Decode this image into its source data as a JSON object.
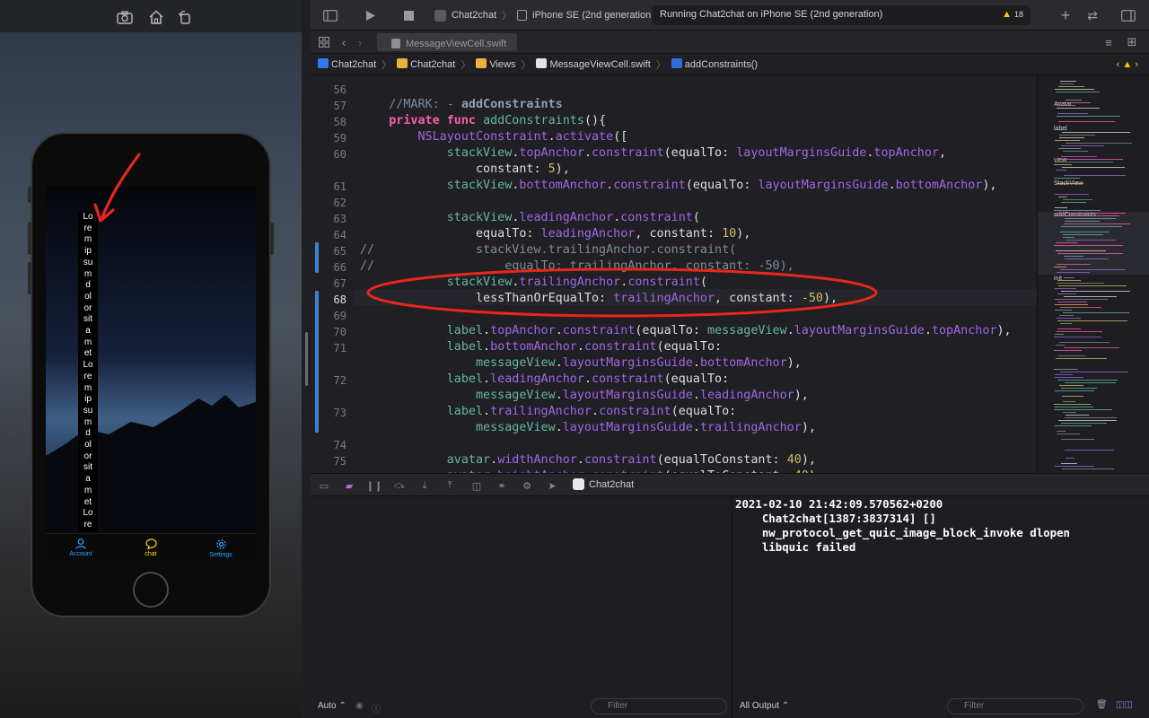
{
  "simulator": {
    "toolbar_icons": [
      "screenshot-icon",
      "home-icon",
      "rotate-icon"
    ],
    "lorem_text": [
      "Lo",
      "re",
      "m",
      "ip",
      "su",
      "m",
      "d",
      "ol",
      "or",
      "sit",
      "a",
      "m",
      "et",
      "Lo",
      "re",
      "m",
      "ip",
      "su",
      "m",
      "d",
      "ol",
      "or",
      "sit",
      "a",
      "m",
      "et",
      "Lo",
      "re"
    ],
    "tabs": [
      {
        "label": "Account",
        "icon": "person-icon"
      },
      {
        "label": "chat",
        "icon": "chat-bubble-icon"
      },
      {
        "label": "Settings",
        "icon": "gear-icon"
      }
    ],
    "colors": {
      "tab_account": "#2aa7ff",
      "tab_chat": "#ffd60a",
      "tab_settings": "#2aa7ff",
      "annotation": "#e8271a"
    }
  },
  "toolbar": {
    "scheme": "Chat2chat",
    "device": "iPhone SE (2nd generation)",
    "status": "Running Chat2chat on iPhone SE (2nd generation)",
    "warnings": "18"
  },
  "tabbar": {
    "file_tab": "MessageViewCell.swift"
  },
  "jumpbar": {
    "items": [
      "Chat2chat",
      "Chat2chat",
      "Views",
      "MessageViewCell.swift",
      "addConstraints()"
    ]
  },
  "editor": {
    "line_numbers": [
      "56",
      "57",
      "58",
      "59",
      "60",
      "",
      "61",
      "62",
      "63",
      "64",
      "65",
      "66",
      "67",
      "68",
      "69",
      "70",
      "71",
      "",
      "72",
      "",
      "73",
      "",
      "74",
      "75"
    ],
    "current_line": "68"
  },
  "minimap": {
    "labels": [
      "Avatar",
      "label",
      "view",
      "StackView",
      "addConstraints",
      "init"
    ]
  },
  "debug": {
    "target": "Chat2chat",
    "auto_label": "Auto",
    "filter_placeholder": "Filter",
    "output_label": "All Output",
    "console_lines": [
      "2021-02-10 21:42:09.570562+0200",
      "    Chat2chat[1387:3837314] []",
      "    nw_protocol_get_quic_image_block_invoke dlopen",
      "    libquic failed"
    ]
  }
}
